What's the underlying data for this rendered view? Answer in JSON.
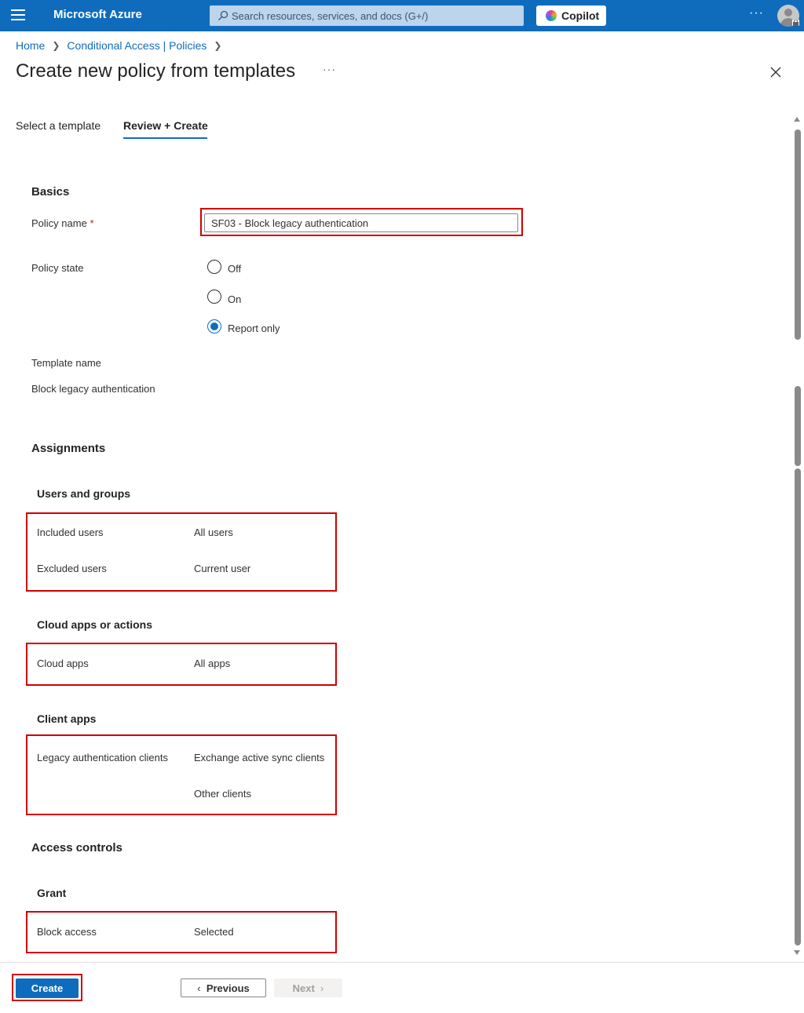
{
  "topbar": {
    "brand": "Microsoft Azure",
    "search_placeholder": "Search resources, services, and docs (G+/)",
    "copilot_label": "Copilot",
    "more": "···"
  },
  "breadcrumb": {
    "items": [
      "Home",
      "Conditional Access | Policies"
    ]
  },
  "page": {
    "title": "Create new policy from templates",
    "more": "···"
  },
  "tabs": [
    {
      "label": "Select a template"
    },
    {
      "label": "Review + Create"
    }
  ],
  "basics": {
    "heading": "Basics",
    "policy_name_label": "Policy name",
    "required_mark": "*",
    "policy_name_value": "SF03 - Block legacy authentication",
    "policy_state_label": "Policy state",
    "policy_state_options": [
      "Off",
      "On",
      "Report only"
    ],
    "policy_state_selected": "Report only",
    "template_name_label": "Template name",
    "template_name_value": "Block legacy authentication"
  },
  "assignments": {
    "heading": "Assignments",
    "users_groups": {
      "heading": "Users and groups",
      "rows": [
        {
          "label": "Included users",
          "value": "All users"
        },
        {
          "label": "Excluded users",
          "value": "Current user"
        }
      ]
    },
    "cloud_apps": {
      "heading": "Cloud apps or actions",
      "rows": [
        {
          "label": "Cloud apps",
          "value": "All apps"
        }
      ]
    },
    "client_apps": {
      "heading": "Client apps",
      "label": "Legacy authentication clients",
      "values": [
        "Exchange active sync clients",
        "Other clients"
      ]
    }
  },
  "access_controls": {
    "heading": "Access controls",
    "grant": {
      "heading": "Grant",
      "label": "Block access",
      "value": "Selected"
    }
  },
  "footer": {
    "create_label": "Create",
    "previous_label": "Previous",
    "next_label": "Next"
  }
}
